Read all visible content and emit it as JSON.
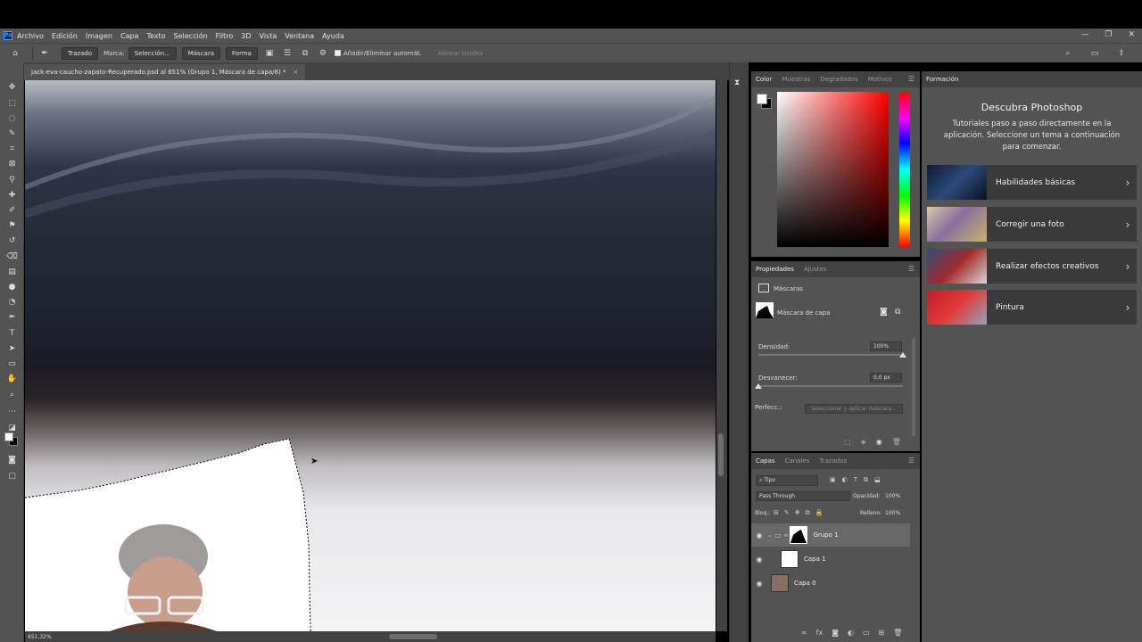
{
  "menu": {
    "logo": "Ps",
    "items": [
      "Archivo",
      "Edición",
      "Imagen",
      "Capa",
      "Texto",
      "Selección",
      "Filtro",
      "3D",
      "Vista",
      "Ventana",
      "Ayuda"
    ]
  },
  "options": {
    "mode_value": "Trazado",
    "marca_label": "Marca:",
    "seleccion_btn": "Selección...",
    "mascara_btn": "Máscara",
    "forma_btn": "Forma",
    "auto_add_label": "Añadir/Eliminar automát.",
    "align_edges_label": "Alinear bordes"
  },
  "document": {
    "tab_title": "jack-eva-caucho-zapato-Recuperado.psd al 651% (Grupo 1, Máscara de capa/8) *",
    "zoom": "651,32%"
  },
  "color_panel": {
    "tabs": [
      "Color",
      "Muestras",
      "Degradados",
      "Motivos"
    ],
    "fg": "#ffffff",
    "bg": "#000000"
  },
  "properties": {
    "tabs": [
      "Propiedades",
      "Ajustes"
    ],
    "masks_label": "Máscaras",
    "layer_mask_label": "Máscara de capa",
    "density_label": "Densidad:",
    "density_value": "100%",
    "density_fraction": 1.0,
    "feather_label": "Desvanecer:",
    "feather_value": "0,0 px",
    "feather_fraction": 0.0,
    "refine_label": "Perfecc.:",
    "refine_button": "Seleccionar y aplicar máscara..."
  },
  "layers": {
    "tabs": [
      "Capas",
      "Canales",
      "Trazados"
    ],
    "filter_kind": "Tipo",
    "blend_mode": "Pass Through",
    "opacity_label": "Opacidad:",
    "opacity_value": "100%",
    "lock_label": "Bloq.:",
    "fill_label": "Relleno:",
    "fill_value": "100%",
    "items": [
      {
        "name": "Grupo 1",
        "selected": true
      },
      {
        "name": "Capa 1",
        "selected": false
      },
      {
        "name": "Capa 0",
        "selected": false
      }
    ]
  },
  "learn": {
    "tab": "Formación",
    "title": "Descubra Photoshop",
    "description": "Tutoriales paso a paso directamente en la aplicación. Seleccione un tema a continuación para comenzar.",
    "cards": [
      {
        "label": "Habilidades básicas"
      },
      {
        "label": "Corregir una foto"
      },
      {
        "label": "Realizar efectos creativos"
      },
      {
        "label": "Pintura"
      }
    ]
  }
}
